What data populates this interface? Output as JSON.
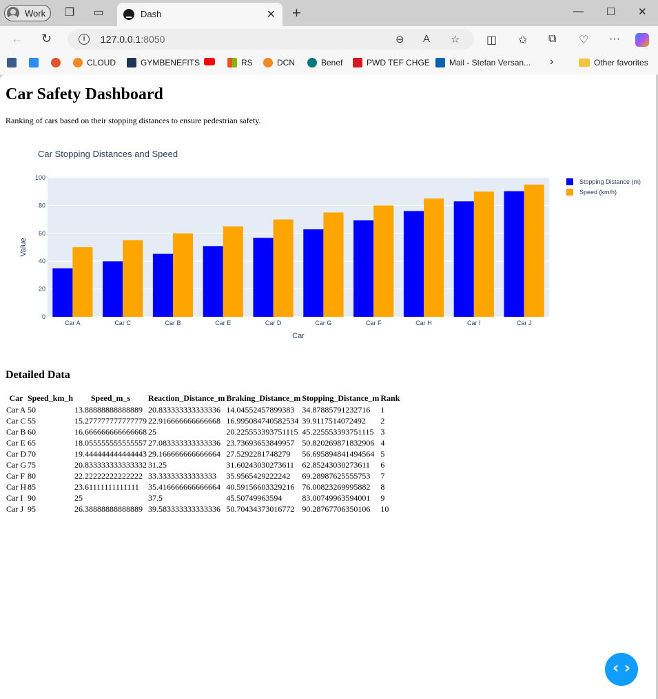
{
  "browser": {
    "profile_label": "Work",
    "tab_title": "Dash",
    "url_host": "127.0.0.1",
    "url_port": ":8050",
    "bookmarks": [
      "CLOUD",
      "GYMBENEFITS",
      "RS",
      "DCN",
      "Benef",
      "PWD TEF CHGE",
      "Mail - Stefan Versan..."
    ],
    "other_favorites": "Other favorites"
  },
  "page": {
    "title": "Car Safety Dashboard",
    "subtitle": "Ranking of cars based on their stopping distances to ensure pedestrian safety.",
    "table_heading": "Detailed Data"
  },
  "chart_data": {
    "type": "bar",
    "title": "Car Stopping Distances and Speed",
    "xlabel": "Car",
    "ylabel": "Value",
    "ylim": [
      0,
      100
    ],
    "yticks": [
      0,
      20,
      40,
      60,
      80,
      100
    ],
    "categories": [
      "Car A",
      "Car C",
      "Car B",
      "Car E",
      "Car D",
      "Car G",
      "Car F",
      "Car H",
      "Car I",
      "Car J"
    ],
    "series": [
      {
        "name": "Stopping Distance (m)",
        "color": "#0000ff",
        "values": [
          34.88,
          39.91,
          45.23,
          50.82,
          56.7,
          62.85,
          69.29,
          76.01,
          83.01,
          90.29
        ]
      },
      {
        "name": "Speed (km/h)",
        "color": "#ffa500",
        "values": [
          50,
          55,
          60,
          65,
          70,
          75,
          80,
          85,
          90,
          95
        ]
      }
    ],
    "legend": "top-right",
    "grid": true,
    "plot_bgcolor": "#e5ecf6"
  },
  "table": {
    "columns": [
      "Car",
      "Speed_km_h",
      "Speed_m_s",
      "Reaction_Distance_m",
      "Braking_Distance_m",
      "Stopping_Distance_m",
      "Rank"
    ],
    "rows": [
      [
        "Car A",
        "50",
        "13.88888888888889",
        "20.833333333333336",
        "14.04552457899383",
        "34.87885791232716",
        "1"
      ],
      [
        "Car C",
        "55",
        "15.277777777777779",
        "22.916666666666668",
        "16.995084740582534",
        "39.9117514072492",
        "2"
      ],
      [
        "Car B",
        "60",
        "16.666666666666668",
        "25",
        "20.225553393751115",
        "45.225553393751115",
        "3"
      ],
      [
        "Car E",
        "65",
        "18.055555555555557",
        "27.083333333333336",
        "23.73693653849957",
        "50.820269871832906",
        "4"
      ],
      [
        "Car D",
        "70",
        "19.444444444444443",
        "29.166666666666664",
        "27.5292281748279",
        "56.695894841494564",
        "5"
      ],
      [
        "Car G",
        "75",
        "20.833333333333332",
        "31.25",
        "31.60243030273611",
        "62.85243030273611",
        "6"
      ],
      [
        "Car F",
        "80",
        "22.22222222222222",
        "33.33333333333333",
        "35.9565429222242",
        "69.28987625555753",
        "7"
      ],
      [
        "Car H",
        "85",
        "23.61111111111111",
        "35.416666666666664",
        "40.59156603329216",
        "76.00823269995882",
        "8"
      ],
      [
        "Car I",
        "90",
        "25",
        "37.5",
        "45.50749963594",
        "83.00749963594001",
        "9"
      ],
      [
        "Car J",
        "95",
        "26.38888888888889",
        "39.583333333333336",
        "50.70434373016772",
        "90.28767706350106",
        "10"
      ]
    ]
  }
}
